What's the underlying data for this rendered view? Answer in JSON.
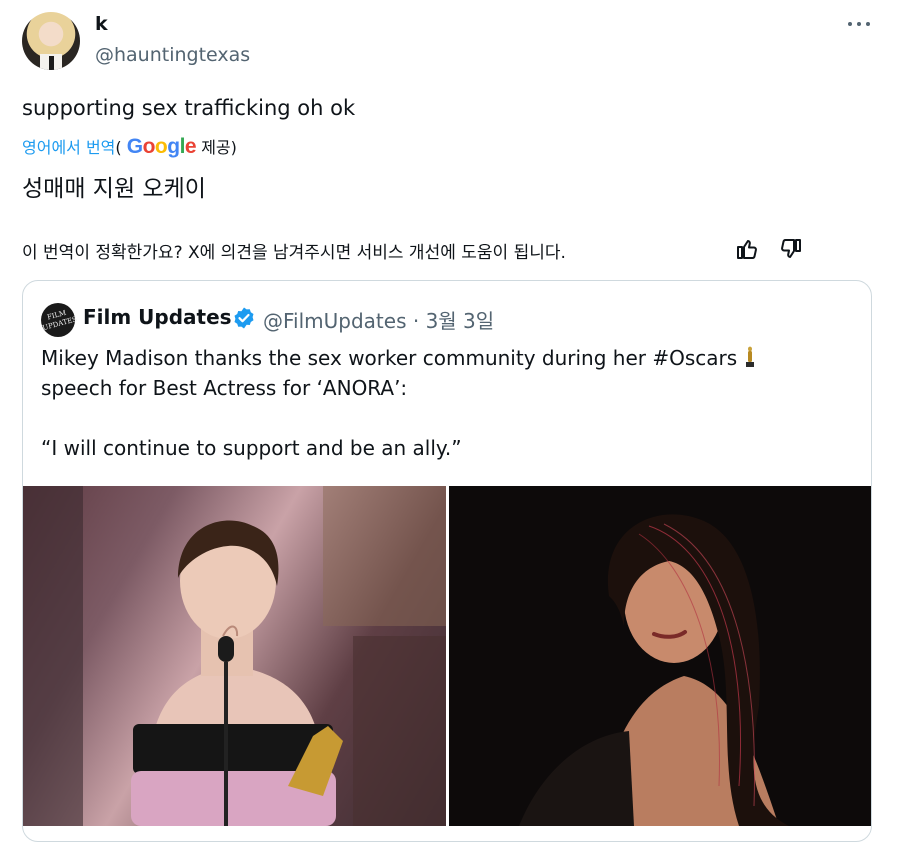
{
  "tweet": {
    "author_name": "k",
    "author_handle": "@hauntingtexas",
    "text": "supporting sex trafficking oh ok",
    "translated_from": "영어에서 번역",
    "translated_paren_open": "(",
    "translated_provider": "Google",
    "translated_provided": "제공)",
    "translation": "성매매 지원 오케이",
    "feedback_prompt": "이 번역이 정확한가요? X에 의견을 남겨주시면 서비스 개선에 도움이 됩니다."
  },
  "quoted": {
    "author_name": "Film Updates",
    "author_handle": "@FilmUpdates",
    "separator": "·",
    "date": "3월 3일",
    "line1": "Mikey Madison thanks the sex worker community during her #Oscars",
    "line2": "speech for Best Actress for ‘ANORA’:",
    "line3": "“I will continue to support and be an ally.”",
    "avatar_text": "FILM UPDATES"
  },
  "icons": [
    "more-icon",
    "thumbs-up-icon",
    "thumbs-down-icon",
    "verified-badge-icon",
    "trophy-icon"
  ],
  "colors": {
    "link": "#1d9bf0",
    "secondary": "#536471",
    "verified": "#1d9bf0",
    "border": "#cfd9de"
  }
}
